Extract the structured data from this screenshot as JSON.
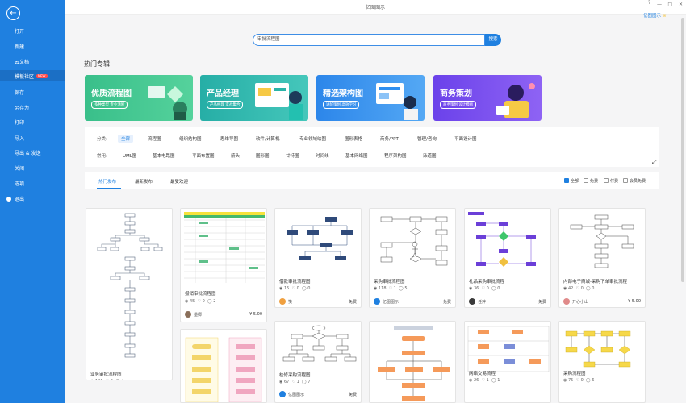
{
  "app": {
    "title": "亿图图示",
    "user": "亿图图示"
  },
  "sidebar": {
    "items": [
      {
        "label": "打开"
      },
      {
        "label": "新建"
      },
      {
        "label": "云文档"
      },
      {
        "label": "模板社区",
        "badge": "NEW"
      },
      {
        "label": "保存"
      },
      {
        "label": "另存为"
      },
      {
        "label": "打印"
      },
      {
        "label": "导入"
      },
      {
        "label": "导出 & 发送"
      },
      {
        "label": "关闭"
      },
      {
        "label": "选项"
      },
      {
        "label": "退出"
      }
    ]
  },
  "search": {
    "value": "审批流程图",
    "button": "搜索"
  },
  "section": {
    "title": "热门专辑"
  },
  "banners": [
    {
      "title": "优质流程图",
      "subtitle": "多种类型 专业清晰",
      "color": "#3fc38f"
    },
    {
      "title": "产品经理",
      "subtitle": "产品经理 实战集合",
      "color": "#2ab4a8"
    },
    {
      "title": "精选架构图",
      "subtitle": "进阶策划 高效学习",
      "color": "#2f8ff0"
    },
    {
      "title": "商务策划",
      "subtitle": "商务策划 设计模板",
      "color": "#7b4ef0"
    }
  ],
  "filters": {
    "row1_label": "分类:",
    "row1": [
      "全部",
      "流程图",
      "组织结构图",
      "思维导图",
      "软件/计算机",
      "专业领域绘图",
      "图形表格",
      "商务/PPT",
      "管理/咨询",
      "平面设计图"
    ],
    "row2_label": "常用:",
    "row2": [
      "UML图",
      "基本电路图",
      "平面布置图",
      "箭头",
      "图形图",
      "甘特图",
      "时间线",
      "基本网络图",
      "程序架构图",
      "泳道图"
    ]
  },
  "tabs": [
    "热门发布",
    "最新发布",
    "最受欢迎"
  ],
  "checks": [
    "全部",
    "免费",
    "付费",
    "会员免费"
  ],
  "cards": [
    {
      "name": "业务审批流程图",
      "views": "141",
      "likes": "0",
      "comments": "4"
    },
    {
      "name": "报销审批流程图",
      "views": "45",
      "likes": "0",
      "comments": "2",
      "author": "墨卿",
      "price": "¥ 5.00"
    },
    {
      "name": "借款审批流程图",
      "views": "15",
      "likes": "0",
      "comments": "0",
      "author": "笺",
      "price": "免费"
    },
    {
      "name": "采购审批流程图",
      "views": "118",
      "likes": "1",
      "comments": "5",
      "author": "亿图图示",
      "price": "免费"
    },
    {
      "name": "礼品采购审批流程",
      "views": "36",
      "likes": "0",
      "comments": "0",
      "author": "任萍",
      "price": "免费"
    },
    {
      "name": "内部电子商城-采购下单审批流程",
      "views": "42",
      "likes": "0",
      "comments": "0",
      "author": "开心小山",
      "price": "¥ 5.00"
    },
    {
      "name": "",
      "views": "",
      "likes": "",
      "comments": ""
    },
    {
      "name": "检修采购流程图",
      "views": "67",
      "likes": "1",
      "comments": "7",
      "author": "亿图图示",
      "price": "免费"
    },
    {
      "name": "",
      "views": "",
      "likes": "",
      "comments": ""
    },
    {
      "name": "网络交易流程",
      "views": "26",
      "likes": "1",
      "comments": "1"
    },
    {
      "name": "采购流程图",
      "views": "75",
      "likes": "0",
      "comments": "6"
    }
  ]
}
